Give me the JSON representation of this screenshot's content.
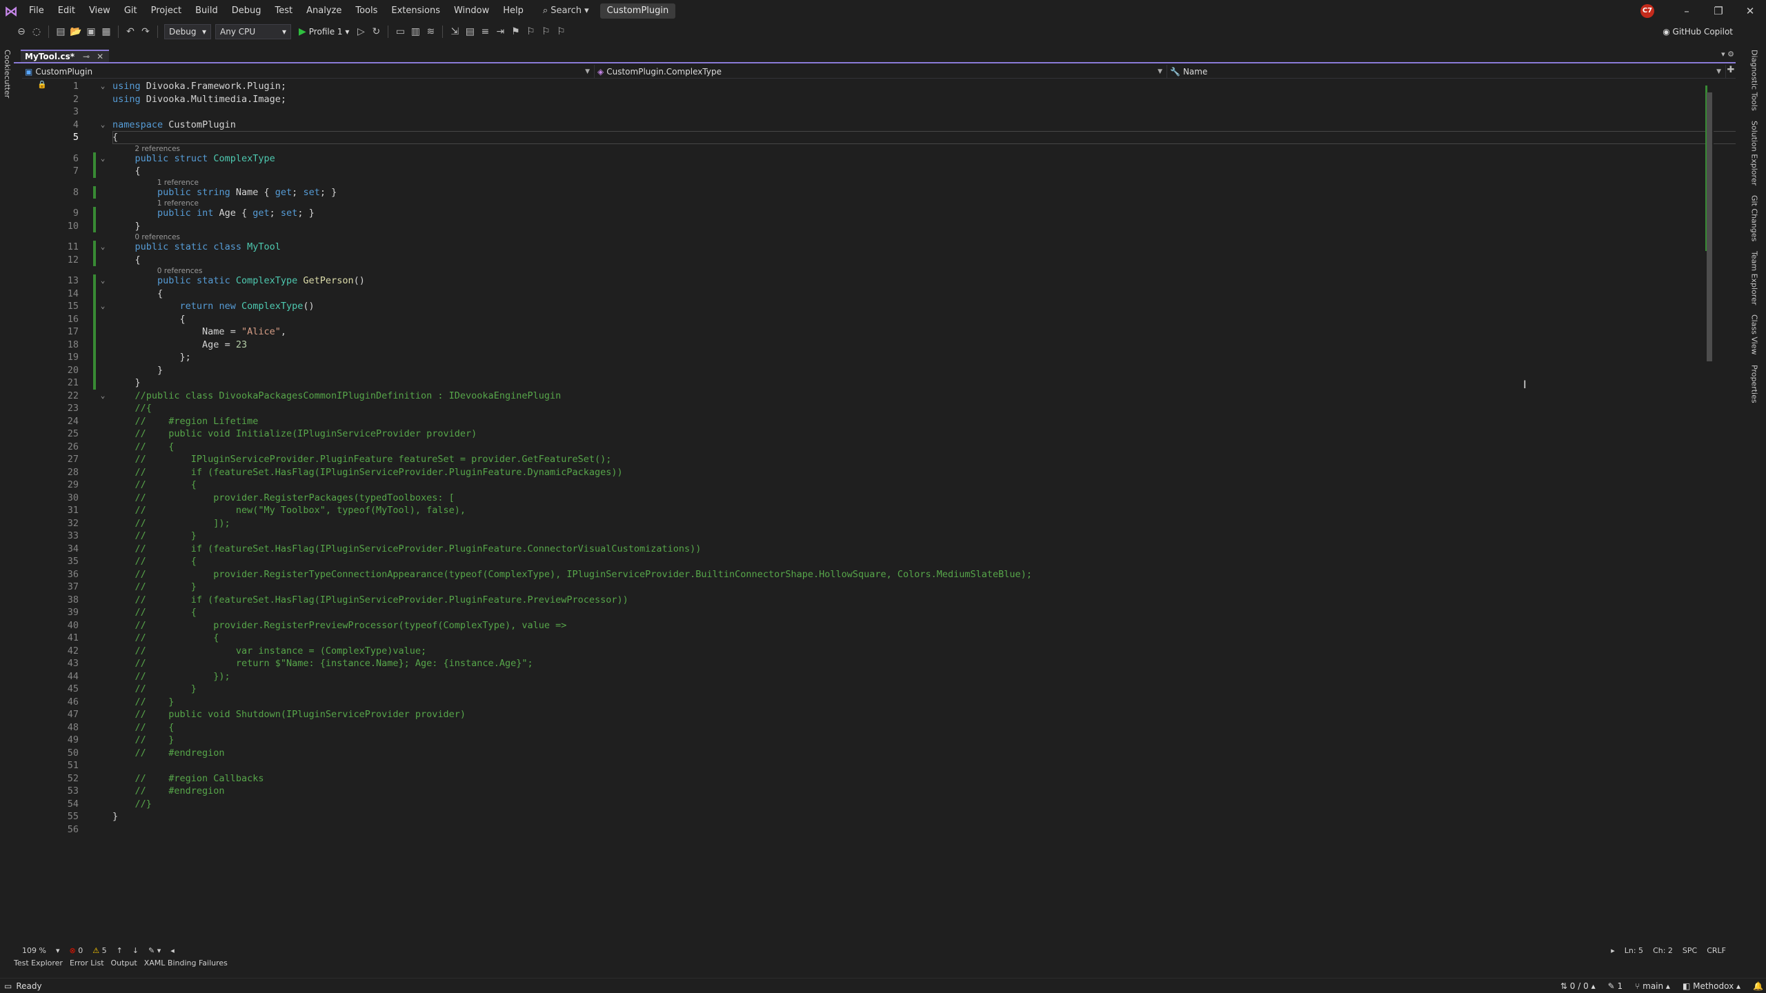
{
  "menubar": {
    "items": [
      "File",
      "Edit",
      "View",
      "Git",
      "Project",
      "Build",
      "Debug",
      "Test",
      "Analyze",
      "Tools",
      "Extensions",
      "Window",
      "Help"
    ],
    "search_label": "Search",
    "solution_name": "CustomPlugin",
    "avatar_initials": "C7"
  },
  "toolbar": {
    "configuration": "Debug",
    "platform": "Any CPU",
    "run_profile": "Profile 1",
    "copilot_label": "GitHub Copilot"
  },
  "left_tool_tab": "Cookiecutter",
  "right_tool_tabs": [
    "Diagnostic Tools",
    "Solution Explorer",
    "Git Changes",
    "Team Explorer",
    "Class View",
    "Properties"
  ],
  "document_tab": {
    "title": "MyTool.cs*"
  },
  "navbar": {
    "project": "CustomPlugin",
    "type": "CustomPlugin.ComplexType",
    "member": "Name"
  },
  "editor": {
    "current_line": 5,
    "lines": [
      {
        "n": "1",
        "html": "<span class=\"kw\">using</span> <span class=\"ns\">Divooka.Framework.Plugin</span>;"
      },
      {
        "n": "2",
        "html": "<span class=\"kw\">using</span> <span class=\"ns\">Divooka.Multimedia.Image</span>;"
      },
      {
        "n": "3",
        "html": ""
      },
      {
        "n": "4",
        "html": "<span class=\"kw\">namespace</span> <span class=\"ns\">CustomPlugin</span>"
      },
      {
        "n": "5",
        "html": "{"
      },
      {
        "n": "6",
        "html": "    <span class=\"kw\">public</span> <span class=\"kw\">struct</span> <span class=\"ty\">ComplexType</span>"
      },
      {
        "n": "7",
        "html": "    {"
      },
      {
        "n": "8",
        "html": "        <span class=\"kw\">public</span> <span class=\"kw\">string</span> <span class=\"pr\">Name</span> { <span class=\"kw\">get</span>; <span class=\"kw\">set</span>; }"
      },
      {
        "n": "9",
        "html": "        <span class=\"kw\">public</span> <span class=\"kw\">int</span> <span class=\"pr\">Age</span> { <span class=\"kw\">get</span>; <span class=\"kw\">set</span>; }"
      },
      {
        "n": "10",
        "html": "    }"
      },
      {
        "n": "11",
        "html": "    <span class=\"kw\">public</span> <span class=\"kw\">static</span> <span class=\"kw\">class</span> <span class=\"ty\">MyTool</span>"
      },
      {
        "n": "12",
        "html": "    {"
      },
      {
        "n": "13",
        "html": "        <span class=\"kw\">public</span> <span class=\"kw\">static</span> <span class=\"ty\">ComplexType</span> <span class=\"mt\">GetPerson</span>()"
      },
      {
        "n": "14",
        "html": "        {"
      },
      {
        "n": "15",
        "html": "            <span class=\"kw\">return</span> <span class=\"kw\">new</span> <span class=\"ty\">ComplexType</span>()"
      },
      {
        "n": "16",
        "html": "            {"
      },
      {
        "n": "17",
        "html": "                <span class=\"pr\">Name</span> = <span class=\"st\">\"Alice\"</span>,"
      },
      {
        "n": "18",
        "html": "                <span class=\"pr\">Age</span> = <span class=\"nm\">23</span>"
      },
      {
        "n": "19",
        "html": "            };"
      },
      {
        "n": "20",
        "html": "        }"
      },
      {
        "n": "21",
        "html": "    }"
      },
      {
        "n": "22",
        "html": "    <span class=\"cm\">//public class DivookaPackagesCommonIPluginDefinition : IDevookaEnginePlugin</span>"
      },
      {
        "n": "23",
        "html": "    <span class=\"cm\">//{</span>"
      },
      {
        "n": "24",
        "html": "    <span class=\"cm\">//    #region Lifetime</span>"
      },
      {
        "n": "25",
        "html": "    <span class=\"cm\">//    public void Initialize(IPluginServiceProvider provider)</span>"
      },
      {
        "n": "26",
        "html": "    <span class=\"cm\">//    {</span>"
      },
      {
        "n": "27",
        "html": "    <span class=\"cm\">//        IPluginServiceProvider.PluginFeature featureSet = provider.GetFeatureSet();</span>"
      },
      {
        "n": "28",
        "html": "    <span class=\"cm\">//        if (featureSet.HasFlag(IPluginServiceProvider.PluginFeature.DynamicPackages))</span>"
      },
      {
        "n": "29",
        "html": "    <span class=\"cm\">//        {</span>"
      },
      {
        "n": "30",
        "html": "    <span class=\"cm\">//            provider.RegisterPackages(typedToolboxes: [</span>"
      },
      {
        "n": "31",
        "html": "    <span class=\"cm\">//                new(\"My Toolbox\", typeof(MyTool), false),</span>"
      },
      {
        "n": "32",
        "html": "    <span class=\"cm\">//            ]);</span>"
      },
      {
        "n": "33",
        "html": "    <span class=\"cm\">//        }</span>"
      },
      {
        "n": "34",
        "html": "    <span class=\"cm\">//        if (featureSet.HasFlag(IPluginServiceProvider.PluginFeature.ConnectorVisualCustomizations))</span>"
      },
      {
        "n": "35",
        "html": "    <span class=\"cm\">//        {</span>"
      },
      {
        "n": "36",
        "html": "    <span class=\"cm\">//            provider.RegisterTypeConnectionAppearance(typeof(ComplexType), IPluginServiceProvider.BuiltinConnectorShape.HollowSquare, Colors.MediumSlateBlue);</span>"
      },
      {
        "n": "37",
        "html": "    <span class=\"cm\">//        }</span>"
      },
      {
        "n": "38",
        "html": "    <span class=\"cm\">//        if (featureSet.HasFlag(IPluginServiceProvider.PluginFeature.PreviewProcessor))</span>"
      },
      {
        "n": "39",
        "html": "    <span class=\"cm\">//        {</span>"
      },
      {
        "n": "40",
        "html": "    <span class=\"cm\">//            provider.RegisterPreviewProcessor(typeof(ComplexType), value =></span>"
      },
      {
        "n": "41",
        "html": "    <span class=\"cm\">//            {</span>"
      },
      {
        "n": "42",
        "html": "    <span class=\"cm\">//                var instance = (ComplexType)value;</span>"
      },
      {
        "n": "43",
        "html": "    <span class=\"cm\">//                return $\"Name: {instance.Name}; Age: {instance.Age}\";</span>"
      },
      {
        "n": "44",
        "html": "    <span class=\"cm\">//            });</span>"
      },
      {
        "n": "45",
        "html": "    <span class=\"cm\">//        }</span>"
      },
      {
        "n": "46",
        "html": "    <span class=\"cm\">//    }</span>"
      },
      {
        "n": "47",
        "html": "    <span class=\"cm\">//    public void Shutdown(IPluginServiceProvider provider)</span>"
      },
      {
        "n": "48",
        "html": "    <span class=\"cm\">//    {</span>"
      },
      {
        "n": "49",
        "html": "    <span class=\"cm\">//    }</span>"
      },
      {
        "n": "50",
        "html": "    <span class=\"cm\">//    #endregion</span>"
      },
      {
        "n": "51",
        "html": ""
      },
      {
        "n": "52",
        "html": "    <span class=\"cm\">//    #region Callbacks</span>"
      },
      {
        "n": "53",
        "html": "    <span class=\"cm\">//    #endregion</span>"
      },
      {
        "n": "54",
        "html": "    <span class=\"cm\">//}</span>"
      },
      {
        "n": "55",
        "html": "}"
      },
      {
        "n": "56",
        "html": ""
      }
    ],
    "codelens": [
      {
        "text": "2 references",
        "before_line": "6"
      },
      {
        "text": "1 reference",
        "before_line": "8"
      },
      {
        "text": "1 reference",
        "before_line": "9"
      },
      {
        "text": "0 references",
        "before_line": "11"
      },
      {
        "text": "0 references",
        "before_line": "13"
      }
    ]
  },
  "editor_status": {
    "zoom": "109 %",
    "errors": "0",
    "warnings": "5",
    "line": "Ln: 5",
    "col": "Ch: 2",
    "whitespace": "SPC",
    "line_ending": "CRLF"
  },
  "bottom_tabs": [
    "Test Explorer",
    "Error List",
    "Output",
    "XAML Binding Failures"
  ],
  "statusbar": {
    "ready": "Ready",
    "changes": "0 / 0",
    "pending": "1",
    "branch": "main",
    "repo": "Methodox"
  }
}
